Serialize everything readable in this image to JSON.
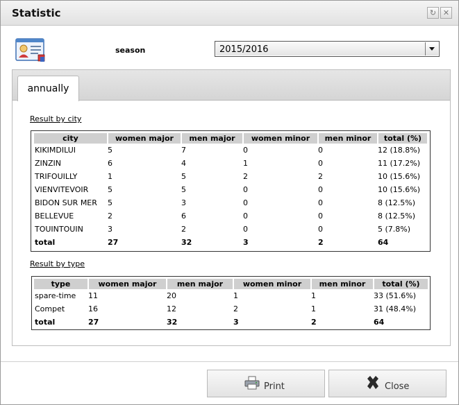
{
  "window": {
    "title": "Statistic"
  },
  "title_buttons": {
    "restore": "↻",
    "close": "✕"
  },
  "season": {
    "label": "season",
    "value": "2015/2016"
  },
  "tabs": [
    {
      "label": "annually"
    }
  ],
  "by_city": {
    "title": "Result by city",
    "headers": [
      "city",
      "women major",
      "men major",
      "women minor",
      "men minor",
      "total (%)"
    ],
    "rows": [
      [
        "KIKIMDILUI",
        "5",
        "7",
        "0",
        "0",
        "12 (18.8%)"
      ],
      [
        "ZINZIN",
        "6",
        "4",
        "1",
        "0",
        "11 (17.2%)"
      ],
      [
        "TRIFOUILLY",
        "1",
        "5",
        "2",
        "2",
        "10 (15.6%)"
      ],
      [
        "VIENVITEVOIR",
        "5",
        "5",
        "0",
        "0",
        "10 (15.6%)"
      ],
      [
        "BIDON SUR MER",
        "5",
        "3",
        "0",
        "0",
        "8 (12.5%)"
      ],
      [
        "BELLEVUE",
        "2",
        "6",
        "0",
        "0",
        "8 (12.5%)"
      ],
      [
        "TOUINTOUIN",
        "3",
        "2",
        "0",
        "0",
        "5 (7.8%)"
      ]
    ],
    "total": [
      "total",
      "27",
      "32",
      "3",
      "2",
      "64"
    ]
  },
  "by_type": {
    "title": "Result by type",
    "headers": [
      "type",
      "women major",
      "men major",
      "women minor",
      "men minor",
      "total (%)"
    ],
    "rows": [
      [
        "spare-time",
        "11",
        "20",
        "1",
        "1",
        "33 (51.6%)"
      ],
      [
        "Compet",
        "16",
        "12",
        "2",
        "1",
        "31 (48.4%)"
      ]
    ],
    "total": [
      "total",
      "27",
      "32",
      "3",
      "2",
      "64"
    ]
  },
  "buttons": {
    "print": "Print",
    "close": "Close"
  },
  "colors": {
    "header_bg": "#cfcfcf",
    "titlebar": "#e8e8e8",
    "tabstrip": "#dcdcdc"
  }
}
